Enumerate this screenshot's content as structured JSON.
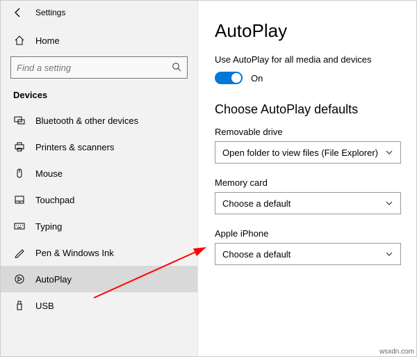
{
  "window_title": "Settings",
  "sidebar": {
    "home_label": "Home",
    "search_placeholder": "Find a setting",
    "section_header": "Devices",
    "items": [
      {
        "label": "Bluetooth & other devices",
        "icon": "bluetooth-devices-icon"
      },
      {
        "label": "Printers & scanners",
        "icon": "printer-icon"
      },
      {
        "label": "Mouse",
        "icon": "mouse-icon"
      },
      {
        "label": "Touchpad",
        "icon": "touchpad-icon"
      },
      {
        "label": "Typing",
        "icon": "keyboard-icon"
      },
      {
        "label": "Pen & Windows Ink",
        "icon": "pen-icon"
      },
      {
        "label": "AutoPlay",
        "icon": "autoplay-icon",
        "selected": true
      },
      {
        "label": "USB",
        "icon": "usb-icon"
      }
    ]
  },
  "main": {
    "page_title": "AutoPlay",
    "master_toggle_text": "Use AutoPlay for all media and devices",
    "master_toggle_state_label": "On",
    "master_toggle_on": true,
    "defaults_header": "Choose AutoPlay defaults",
    "fields": [
      {
        "label": "Removable drive",
        "value": "Open folder to view files (File Explorer)"
      },
      {
        "label": "Memory card",
        "value": "Choose a default"
      },
      {
        "label": "Apple iPhone",
        "value": "Choose a default"
      }
    ]
  },
  "watermark": "wsxdn.com"
}
